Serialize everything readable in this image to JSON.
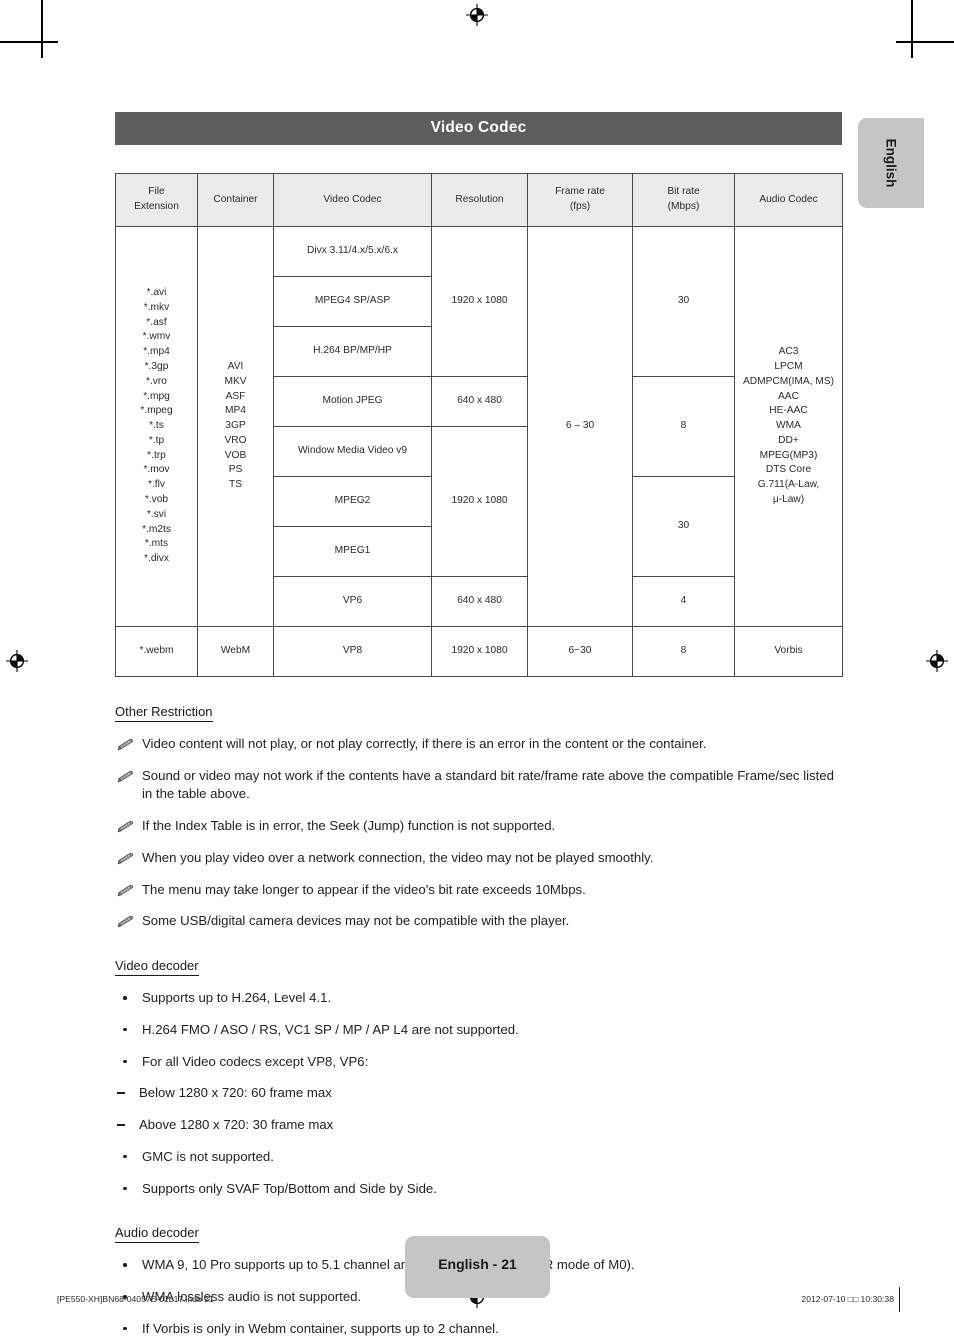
{
  "header": {
    "section_title": "Video Codec"
  },
  "language_tab": {
    "label": "English"
  },
  "table": {
    "columns": [
      {
        "line1": "File",
        "line2": "Extension"
      },
      {
        "line1": "Container",
        "line2": ""
      },
      {
        "line1": "Video Codec",
        "line2": ""
      },
      {
        "line1": "Resolution",
        "line2": ""
      },
      {
        "line1": "Frame rate",
        "line2": "(fps)"
      },
      {
        "line1": "Bit rate",
        "line2": "(Mbps)"
      },
      {
        "line1": "Audio Codec",
        "line2": ""
      }
    ],
    "file_extensions_group1": "*.avi\n*.mkv\n*.asf\n*.wmv\n*.mp4\n*.3gp\n*.vro\n*.mpg\n*.mpeg\n*.ts\n*.tp\n*.trp\n*.mov\n*.flv\n*.vob\n*.svi\n*.m2ts\n*.mts\n*.divx",
    "containers_group1": "AVI\nMKV\nASF\nMP4\n3GP\nVRO\nVOB\nPS\nTS",
    "video_codecs_group1": [
      "Divx 3.11/4.x/5.x/6.x",
      "MPEG4 SP/ASP",
      "H.264 BP/MP/HP",
      "Motion JPEG",
      "Window Media Video v9",
      "MPEG2",
      "MPEG1",
      "VP6"
    ],
    "resolution_1920_a": "1920 x 1080",
    "resolution_640_a": "640 x 480",
    "resolution_1920_b": "1920 x 1080",
    "resolution_640_b": "640 x 480",
    "frame_rate_group1": "6 – 30",
    "bit_rate_30_a": "30",
    "bit_rate_8": "8",
    "bit_rate_30_b": "30",
    "bit_rate_4": "4",
    "audio_codec_group1": "AC3\nLPCM\nADMPCM(IMA, MS)\nAAC\nHE-AAC\nWMA\nDD+\nMPEG(MP3)\nDTS Core\nG.711(A-Law,\nμ-Law)",
    "webm_row": {
      "extension": "*.webm",
      "container": "WebM",
      "video_codec": "VP8",
      "resolution": "1920 x 1080",
      "frame_rate": "6~30",
      "bit_rate": "8",
      "audio_codec": "Vorbis"
    }
  },
  "other_restriction": {
    "heading": "Other Restriction",
    "notes": [
      "Video content will not play, or not play correctly, if there is an error in the content or the container.",
      "Sound or video may not work if the contents have a standard bit rate/frame rate above the compatible Frame/sec listed in the table above.",
      "If the Index Table is in error, the Seek (Jump) function is not supported.",
      "When you play video over a network connection, the video may not be played smoothly.",
      "The menu may take longer to appear if the video's bit rate exceeds 10Mbps.",
      "Some USB/digital camera devices may not be compatible with the player."
    ]
  },
  "video_decoder": {
    "heading": "Video decoder",
    "items": [
      "Supports up to H.264, Level 4.1.",
      "H.264 FMO / ASO / RS, VC1 SP / MP / AP L4 are not supported.",
      "For all Video codecs except VP8, VP6:"
    ],
    "sub_items": [
      "Below 1280 x 720: 60 frame max",
      "Above 1280 x 720: 30 frame max"
    ],
    "items_after": [
      "GMC is not supported.",
      "Supports only SVAF Top/Bottom and Side by Side."
    ]
  },
  "audio_decoder": {
    "heading": "Audio decoder",
    "items": [
      "WMA 9, 10 Pro supports up to 5.1 channel and M2 profile (except LBR mode of M0).",
      "WMA lossless audio is not supported.",
      "If Vorbis is only in Webm container, supports up to 2 channel."
    ]
  },
  "footer": {
    "page_label": "English - 21",
    "file_stamp": "[PE550-XH]BN68-04057E-01L17.indb   21",
    "date_stamp": "2012-07-10   □□ 10:30:38"
  },
  "colors": {
    "title_bar": "#5e5d5d",
    "tab_gray": "#c5c5c5",
    "table_header": "#ebebeb",
    "table_border": "#4a4a4a",
    "text": "#231f20"
  }
}
